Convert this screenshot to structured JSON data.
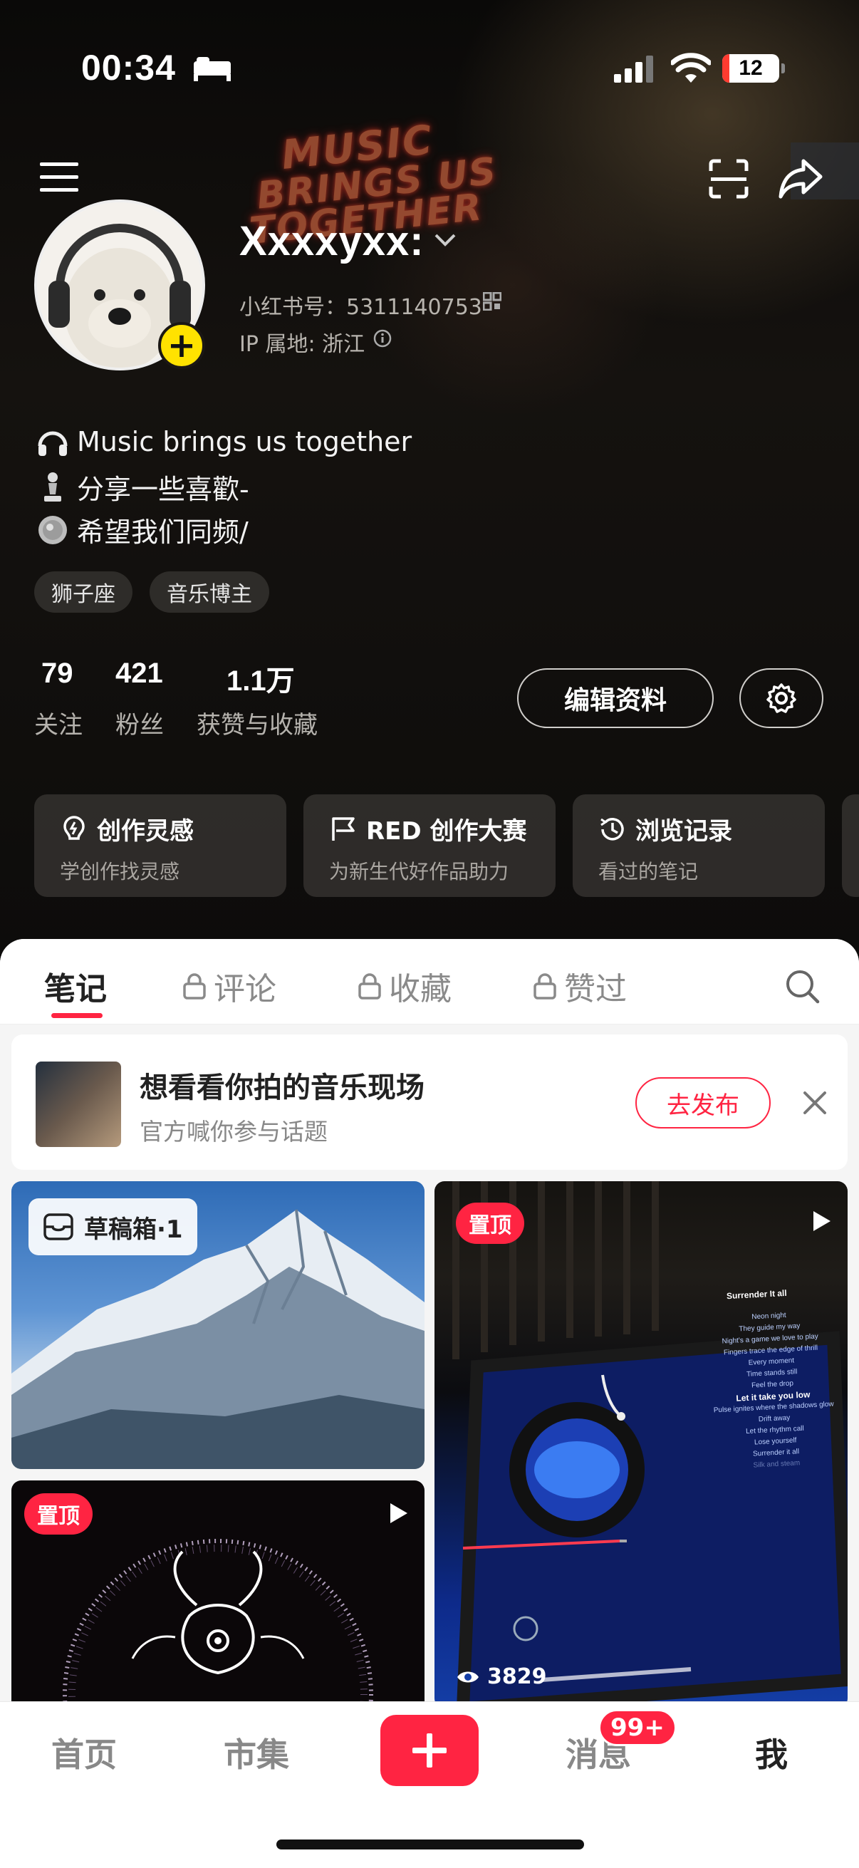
{
  "status_bar": {
    "time": "00:34",
    "battery": "12"
  },
  "profile": {
    "nickname": "Xxxxyxx:",
    "red_id": "小红书号：5311140753",
    "ip_location": "IP 属地: 浙江",
    "bio": [
      {
        "icon": "headphones-icon",
        "text": "Music brings us together"
      },
      {
        "icon": "chess-pawn-icon",
        "text": "分享一些喜歡-"
      },
      {
        "icon": "coin-icon",
        "text": "希望我们同频/"
      }
    ],
    "tags": [
      "狮子座",
      "音乐博主"
    ],
    "stats": [
      {
        "value": "79",
        "label": "关注"
      },
      {
        "value": "421",
        "label": "粉丝"
      },
      {
        "value": "1.1万",
        "label": "获赞与收藏"
      }
    ],
    "edit_label": "编辑资料",
    "neon_sign": [
      "MUSIC",
      "BRINGS US",
      "TOGETHER"
    ]
  },
  "shortcut_cards": [
    {
      "icon": "bulb-icon",
      "title": "创作灵感",
      "subtitle": "学创作找灵感"
    },
    {
      "icon": "flag-icon",
      "title": "RED 创作大赛",
      "subtitle": "为新生代好作品助力"
    },
    {
      "icon": "clock-icon",
      "title": "浏览记录",
      "subtitle": "看过的笔记"
    }
  ],
  "tabs": [
    {
      "label": "笔记",
      "locked": false,
      "active": true
    },
    {
      "label": "评论",
      "locked": true
    },
    {
      "label": "收藏",
      "locked": true
    },
    {
      "label": "赞过",
      "locked": true
    }
  ],
  "topic_banner": {
    "title": "想看看你拍的音乐现场",
    "subtitle": "官方喊你参与话题",
    "button": "去发布"
  },
  "notes": {
    "drafts_label": "草稿箱·1",
    "pin_label": "置顶",
    "view_count": "3829"
  },
  "player_screen": {
    "song": "Surrender It all",
    "lyrics": [
      "Neon night",
      "They guide my way",
      "Night's a game we love to play",
      "Fingers trace the edge of thrill",
      "Every moment",
      "Time stands still",
      "Feel the drop",
      "Let it take you low",
      "Pulse ignites where the shadows glow",
      "Drift away",
      "Let the rhythm call",
      "Lose yourself",
      "Surrender it all",
      "Silk and steam"
    ]
  },
  "bottom_nav": {
    "home": "首页",
    "market": "市集",
    "messages": "消息",
    "me": "我",
    "badge": "99+"
  },
  "colors": {
    "accent": "#ff2442",
    "avatar_badge": "#ffe200"
  }
}
